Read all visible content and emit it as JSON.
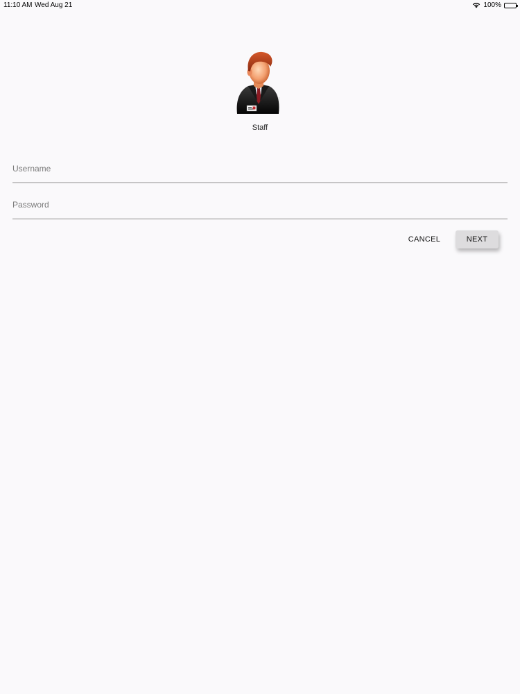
{
  "status_bar": {
    "time": "11:10 AM",
    "date": "Wed Aug 21",
    "battery": "100%",
    "icons": [
      "wifi-icon",
      "battery-icon"
    ]
  },
  "profile": {
    "label": "Staff",
    "icon": "staff-avatar-icon"
  },
  "form": {
    "username_placeholder": "Username",
    "username_value": "",
    "password_placeholder": "Password",
    "password_value": ""
  },
  "actions": {
    "cancel_label": "CANCEL",
    "next_label": "NEXT"
  },
  "colors": {
    "background": "#faf9fb",
    "underline": "#8a8a8a",
    "next_button_bg": "#dddcde"
  }
}
